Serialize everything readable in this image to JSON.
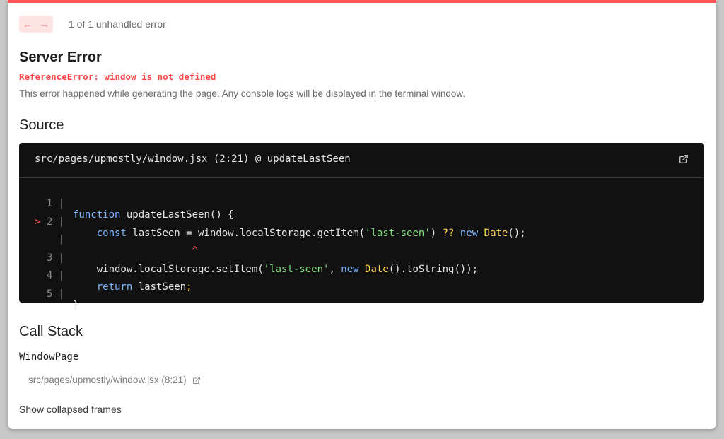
{
  "colors": {
    "accent": "#ff5555",
    "error_text": "#ff4444",
    "code_bg": "#111111"
  },
  "nav": {
    "prev_icon": "arrow-left-icon",
    "next_icon": "arrow-right-icon",
    "prev_glyph": "←",
    "next_glyph": "→",
    "count_label": "1 of 1 unhandled error"
  },
  "error": {
    "title": "Server Error",
    "message": "ReferenceError: window is not defined",
    "description": "This error happened while generating the page. Any console logs will be displayed in the terminal window."
  },
  "source": {
    "heading": "Source",
    "file_label": "src/pages/upmostly/window.jsx (2:21) @ updateLastSeen",
    "open_icon": "external-link-icon",
    "gutters": [
      "  1 | ",
      "> 2 | ",
      "    | ",
      "  3 | ",
      "  4 | ",
      "  5 | "
    ],
    "lines": [
      "function updateLastSeen() {",
      "    const lastSeen = window.localStorage.getItem('last-seen') ?? new Date();",
      "                    ^",
      "    window.localStorage.setItem('last-seen', new Date().toString());",
      "    return lastSeen;",
      "}"
    ]
  },
  "call_stack": {
    "heading": "Call Stack",
    "frames": [
      {
        "name": "WindowPage",
        "location": "src/pages/upmostly/window.jsx (8:21)"
      }
    ],
    "show_collapsed": "Show collapsed frames"
  }
}
